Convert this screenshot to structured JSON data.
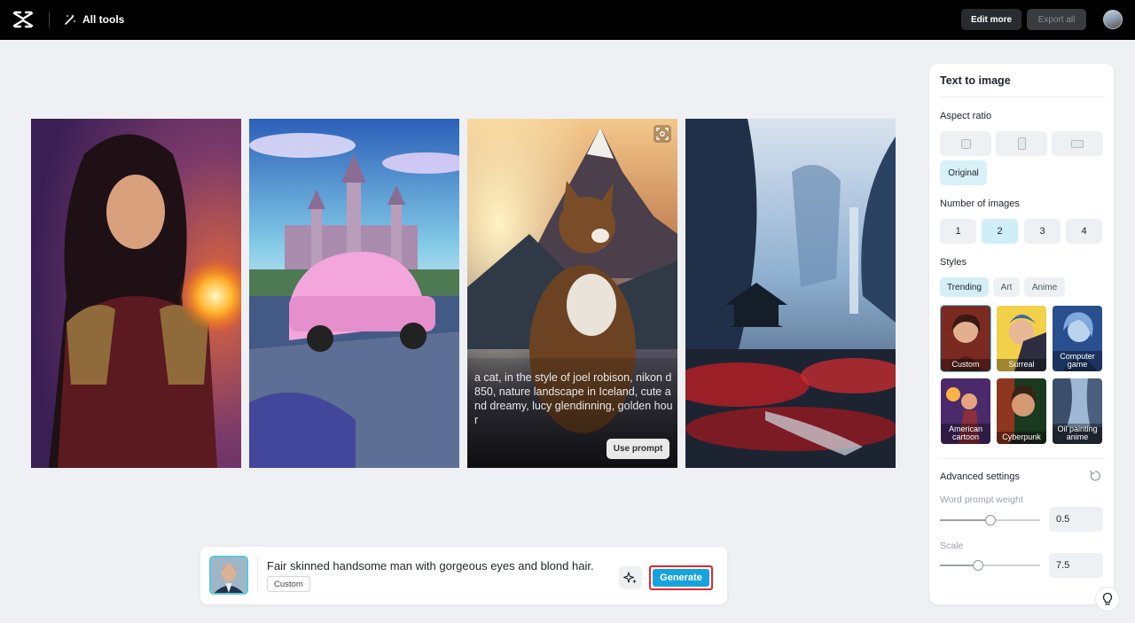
{
  "topbar": {
    "logo_icon": "capcut-logo-icon",
    "all_tools": "All tools",
    "edit_more": "Edit more",
    "export_all": "Export all"
  },
  "gallery": {
    "images": [
      {
        "subject": "warrior-woman-fireball"
      },
      {
        "subject": "pink-car-castle"
      },
      {
        "subject": "cat-mountains"
      },
      {
        "subject": "misty-canyon-pagoda"
      }
    ],
    "hover_prompt": "a cat, in the style of joel robison, nikon d850, nature landscape in Iceland, cute and dreamy, lucy glendinning, golden hour",
    "use_prompt": "Use prompt"
  },
  "panel": {
    "title": "Text to image",
    "aspect_ratio_label": "Aspect ratio",
    "original_label": "Original",
    "num_images_label": "Number of images",
    "num_options": [
      "1",
      "2",
      "3",
      "4"
    ],
    "num_selected": "2",
    "styles_label": "Styles",
    "style_tabs": [
      "Trending",
      "Art",
      "Anime"
    ],
    "style_items": [
      "Custom",
      "Surreal",
      "Computer game",
      "American cartoon",
      "Cyberpunk",
      "Oil painting anime"
    ],
    "advanced_label": "Advanced settings",
    "word_weight_label": "Word prompt weight",
    "word_weight_value": "0.5",
    "scale_label": "Scale",
    "scale_value": "7.5"
  },
  "prompt_bar": {
    "prompt_text": "Fair skinned handsome man with gorgeous eyes and blond hair.",
    "style_tag": "Custom",
    "generate": "Generate"
  },
  "colors": {
    "accent": "#17a2dd",
    "highlight_border": "#e0262b",
    "selected_bg": "#cfeef7"
  }
}
